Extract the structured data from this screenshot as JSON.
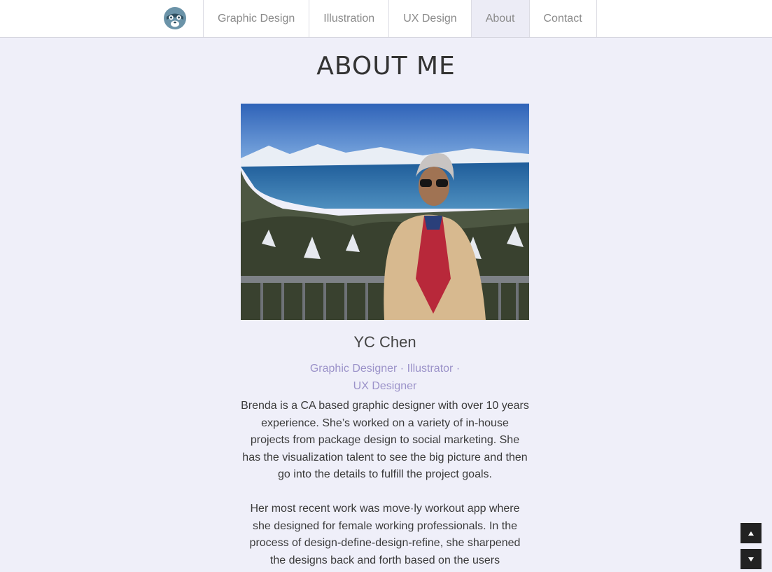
{
  "nav": {
    "logo_icon": "raccoon-logo-icon",
    "items": [
      {
        "label": "Graphic Design"
      },
      {
        "label": "Illustration"
      },
      {
        "label": "UX Design"
      },
      {
        "label": "About",
        "active": true
      },
      {
        "label": "Contact"
      }
    ]
  },
  "page": {
    "title": "ABOUT ME"
  },
  "profile": {
    "name": "YC Chen",
    "roles": [
      "Graphic Designer",
      "Illustrator",
      "UX Designer"
    ],
    "role_separator": "·",
    "bio_paragraphs": [
      "Brenda is a CA based graphic designer with over 10 years experience. She’s worked on a variety of in-house projects from package design to social marketing. She has the visualization talent to see the big picture and then go into the details to fulfill the project goals.",
      "Her most recent work was move·ly workout app where she designed for female working professionals. In the process of design-define-design-refine, she sharpened the designs back and forth based on the users"
    ]
  },
  "scroll": {
    "up_icon": "arrow-up-icon",
    "down_icon": "arrow-down-icon"
  },
  "colors": {
    "background": "#efeff9",
    "accent": "#9b92c9",
    "logo": "#6b93a8"
  }
}
